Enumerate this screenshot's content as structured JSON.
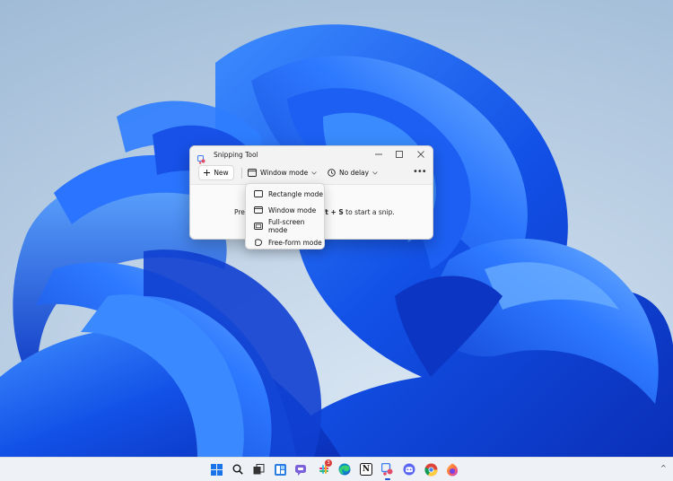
{
  "window": {
    "title": "Snipping Tool",
    "minimize_glyph": "—",
    "maximize_glyph": "☐",
    "close_glyph": "✕"
  },
  "toolbar": {
    "new_label": "New",
    "mode_label": "Window mode",
    "delay_label": "No delay",
    "more_glyph": "•••"
  },
  "content": {
    "hint_prefix": "Pre",
    "hint_key": "ft + S",
    "hint_suffix": " to start a snip."
  },
  "mode_menu": {
    "items": [
      {
        "label": "Rectangle mode",
        "icon": "rectangle-icon"
      },
      {
        "label": "Window mode",
        "icon": "window-icon"
      },
      {
        "label": "Full-screen mode",
        "icon": "fullscreen-icon"
      },
      {
        "label": "Free-form mode",
        "icon": "freeform-icon"
      }
    ]
  },
  "taskbar": {
    "icons": [
      "windows-start-icon",
      "search-icon",
      "task-view-icon",
      "widgets-icon",
      "teams-chat-icon",
      "slack-icon",
      "edge-icon",
      "notion-icon",
      "snipping-tool-icon",
      "discord-icon",
      "chrome-icon",
      "firefox-icon"
    ],
    "slack_badge": "3",
    "notion_glyph": "N",
    "tray_glyph": "^"
  },
  "colors": {
    "accent": "#1b4fd6",
    "wallpaper_blue": "#1456e8",
    "background": "#b8cde2"
  }
}
